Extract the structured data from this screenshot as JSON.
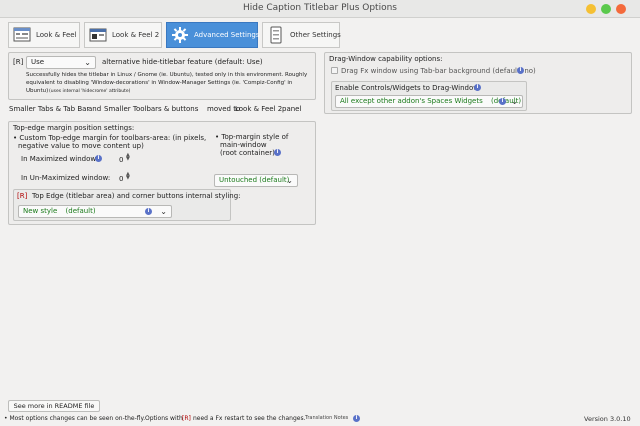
{
  "window": {
    "title": "Hide Caption Titlebar Plus Options"
  },
  "tabs": [
    {
      "label": "Look & Feel",
      "icon": "look-feel-icon"
    },
    {
      "label": "Look & Feel 2",
      "icon": "look-feel-2-icon"
    },
    {
      "label": "Advanced Settings",
      "icon": "gear-icon"
    },
    {
      "label": "Other Settings",
      "icon": "other-settings-icon"
    }
  ],
  "left": {
    "hide_feature": {
      "tag": "[R]",
      "select_value": "Use",
      "label": "alternative hide-titlebar feature (default: Use)",
      "desc_line1": "Successfully hides the titlebar in Linux / Gnome (ie. Ubuntu), tested only in this environment. Roughly",
      "desc_line2": "equivalent to disabling 'Window-decorations' in Window-Manager Settings (ie. 'Compiz-Config' in",
      "desc_line3": "Ubuntu)",
      "desc_note": "(uses internal 'hidecrome' attribute)"
    },
    "moved_note": {
      "a": "Smaller Tabs & Tab Bar",
      "and": "and",
      "b": "Smaller Toolbars & buttons",
      "moved": "moved to",
      "target": "Look & Feel 2",
      "panel": "panel"
    },
    "top_edge": {
      "heading": "Top-edge margin position settings:",
      "custom_line1": "• Custom Top-edge margin for toolbars-area: (in pixels,",
      "custom_line2": "negative value to move content up)",
      "maximized_label": "In Maximized window:",
      "maximized_value": "0",
      "unmaximized_label": "In Un-Maximized window:",
      "unmaximized_value": "0",
      "style_line1": "• Top-margin style of",
      "style_line2": "main-window",
      "style_line3": "(root container).",
      "style_value": "Untouched (default)",
      "corner": {
        "tag": "[R]",
        "label": "Top Edge (titlebar area) and corner buttons internal styling:",
        "select_value": "New style",
        "select_suffix": "(default)"
      }
    }
  },
  "right": {
    "heading": "Drag-Window capability options:",
    "drag_fx_label": "Drag Fx window using Tab-bar background (default: no)",
    "controls": {
      "label": "Enable Controls/Widgets to Drag-Window",
      "select_value": "All except other addon's Spaces Widgets",
      "select_suffix": "(default)"
    }
  },
  "footer": {
    "readme_button": "See more in README file",
    "note_prefix": "• Most options changes can be seen on-the-fly.",
    "note_options_with": "Options with",
    "note_tag": "[R]",
    "note_suffix": "need a Fx restart to see the changes.",
    "translation_notes": "Translation Notes",
    "version": "Version 3.0.10"
  },
  "colors": {
    "window_close": "#f46a3c",
    "window_minimize": "#f5c033",
    "window_maximize": "#5ac94c",
    "active_tab": "#4a90d9",
    "value_green": "#1a7a1a",
    "tag_red": "#b00000"
  }
}
